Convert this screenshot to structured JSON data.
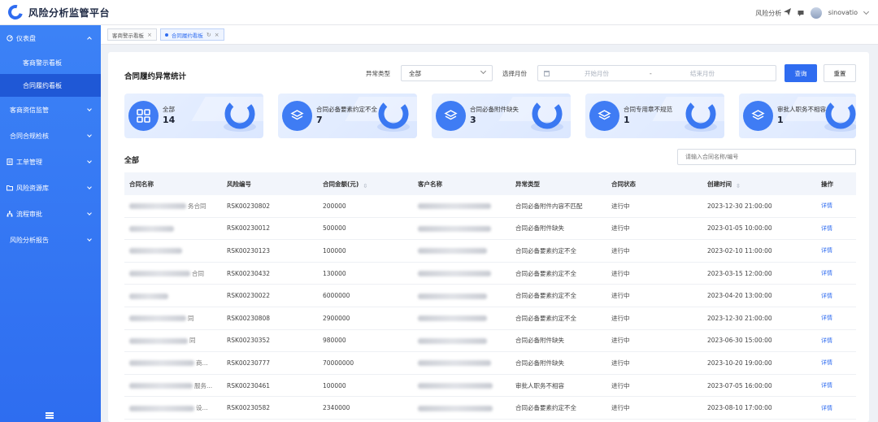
{
  "app": {
    "title": "风险分析监管平台",
    "brand_color": "#2f6cf0"
  },
  "topbar": {
    "risk_label": "风险分析",
    "username": "sinovatio"
  },
  "sidebar": {
    "items": [
      {
        "label": "仪表盘",
        "icon": "dashboard-icon",
        "expanded": true,
        "children": [
          {
            "label": "客商警示看板",
            "active": false
          },
          {
            "label": "合同履约看板",
            "active": true
          }
        ]
      },
      {
        "label": "客商资信监管",
        "icon": "",
        "expanded": false
      },
      {
        "label": "合同合规检核",
        "icon": "",
        "expanded": false
      },
      {
        "label": "工单管理",
        "icon": "document-icon",
        "expanded": false
      },
      {
        "label": "风险资源库",
        "icon": "folder-icon",
        "expanded": false
      },
      {
        "label": "流程审批",
        "icon": "flow-icon",
        "expanded": false
      },
      {
        "label": "风险分析报告",
        "icon": "",
        "expanded": false
      }
    ]
  },
  "tabs": [
    {
      "label": "客商警示看板",
      "active": false
    },
    {
      "label": "合同履约看板",
      "active": true
    }
  ],
  "panel": {
    "title": "合同履约异常统计",
    "filter_type_label": "异常类型",
    "filter_type_value": "全部",
    "filter_month_label": "选择月份",
    "start_placeholder": "开始月份",
    "end_placeholder": "结束月份",
    "date_sep": "-",
    "query_button": "查询",
    "reset_button": "重置"
  },
  "cards": [
    {
      "label": "全部",
      "value": "14"
    },
    {
      "label": "合同必备要素约定不全",
      "value": "7"
    },
    {
      "label": "合同必备附件缺失",
      "value": "3"
    },
    {
      "label": "合同专用章不规范",
      "value": "1"
    },
    {
      "label": "审批人职务不相容",
      "value": "1"
    }
  ],
  "table": {
    "section_title": "全部",
    "search_placeholder": "请输入合同名称/编号",
    "columns": [
      "合同名称",
      "风险编号",
      "合同金额(元)",
      "客户名称",
      "异常类型",
      "合同状态",
      "创建时间",
      "操作"
    ],
    "rows": [
      {
        "name_suffix": "务合同",
        "risk_no": "RSK00230802",
        "amount": "200000",
        "type": "合同必备附件内容不匹配",
        "status": "进行中",
        "created": "2023-12-30 21:00:00",
        "action": "详情"
      },
      {
        "name_suffix": "",
        "risk_no": "RSK00230012",
        "amount": "500000",
        "type": "合同必备附件缺失",
        "status": "进行中",
        "created": "2023-01-05 10:00:00",
        "action": "详情"
      },
      {
        "name_suffix": "",
        "risk_no": "RSK00230123",
        "amount": "100000",
        "type": "合同必备要素约定不全",
        "status": "进行中",
        "created": "2023-02-10 11:00:00",
        "action": "详情"
      },
      {
        "name_suffix": "合同",
        "risk_no": "RSK00230432",
        "amount": "130000",
        "type": "合同必备要素约定不全",
        "status": "进行中",
        "created": "2023-03-15 12:00:00",
        "action": "详情"
      },
      {
        "name_suffix": "",
        "risk_no": "RSK00230022",
        "amount": "6000000",
        "type": "合同必备要素约定不全",
        "status": "进行中",
        "created": "2023-04-20 13:00:00",
        "action": "详情"
      },
      {
        "name_suffix": "同",
        "risk_no": "RSK00230808",
        "amount": "2900000",
        "type": "合同必备要素约定不全",
        "status": "进行中",
        "created": "2023-12-30 21:00:00",
        "action": "详情"
      },
      {
        "name_suffix": "同",
        "risk_no": "RSK00230352",
        "amount": "980000",
        "type": "合同必备附件缺失",
        "status": "进行中",
        "created": "2023-06-30 15:00:00",
        "action": "详情"
      },
      {
        "name_suffix": "商...",
        "risk_no": "RSK00230777",
        "amount": "70000000",
        "type": "合同必备附件缺失",
        "status": "进行中",
        "created": "2023-10-20 19:00:00",
        "action": "详情"
      },
      {
        "name_suffix": "服务...",
        "risk_no": "RSK00230461",
        "amount": "100000",
        "type": "审批人职务不相容",
        "status": "进行中",
        "created": "2023-07-05 16:00:00",
        "action": "详情"
      },
      {
        "name_suffix": "设...",
        "risk_no": "RSK00230582",
        "amount": "2340000",
        "type": "合同必备要素约定不全",
        "status": "进行中",
        "created": "2023-08-10 17:00:00",
        "action": "详情"
      }
    ]
  }
}
